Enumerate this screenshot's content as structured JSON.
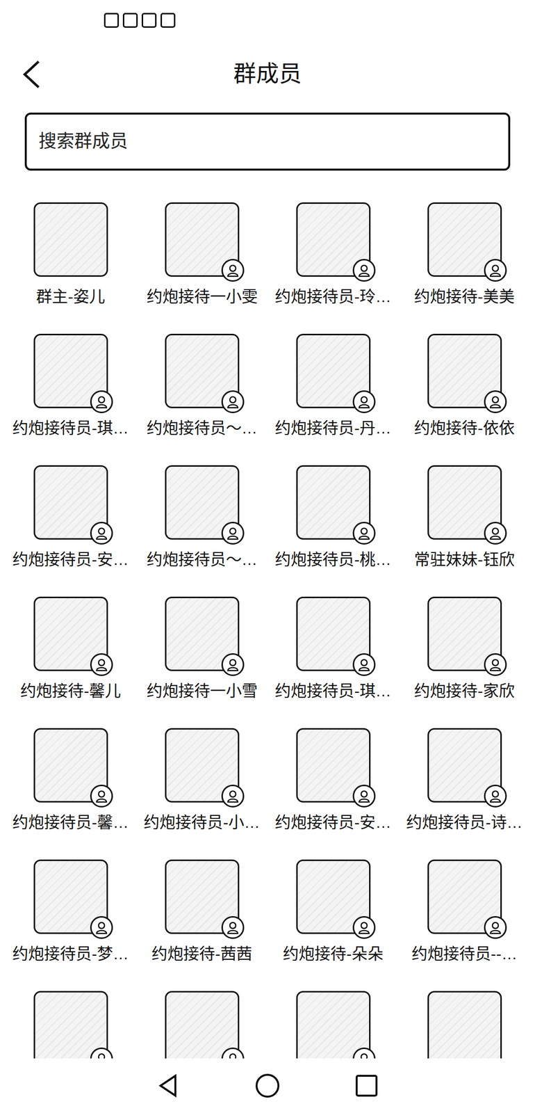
{
  "header": {
    "title": "群成员"
  },
  "search": {
    "placeholder": "搜索群成员"
  },
  "members": [
    {
      "label": "群主-姿儿",
      "badge": false
    },
    {
      "label": "约炮接待一小雯",
      "badge": true
    },
    {
      "label": "约炮接待员-玲…",
      "badge": true
    },
    {
      "label": "约炮接待-美美",
      "badge": true
    },
    {
      "label": "约炮接待员-琪…",
      "badge": true
    },
    {
      "label": "约炮接待员～…",
      "badge": true
    },
    {
      "label": "约炮接待员-丹…",
      "badge": true
    },
    {
      "label": "约炮接待-依依",
      "badge": true
    },
    {
      "label": "约炮接待员-安…",
      "badge": true
    },
    {
      "label": "约炮接待员～…",
      "badge": true
    },
    {
      "label": "约炮接待员-桃…",
      "badge": true
    },
    {
      "label": "常驻妹妹-钰欣",
      "badge": true
    },
    {
      "label": "约炮接待-馨儿",
      "badge": true
    },
    {
      "label": "约炮接待一小雪",
      "badge": true
    },
    {
      "label": "约炮接待员-琪…",
      "badge": true
    },
    {
      "label": "约炮接待-家欣",
      "badge": true
    },
    {
      "label": "约炮接待员-馨…",
      "badge": true
    },
    {
      "label": "约炮接待员-小…",
      "badge": true
    },
    {
      "label": "约炮接待员-安…",
      "badge": true
    },
    {
      "label": "约炮接待员-诗…",
      "badge": true
    },
    {
      "label": "约炮接待员-梦…",
      "badge": true
    },
    {
      "label": "约炮接待-茜茜",
      "badge": true
    },
    {
      "label": "约炮接待-朵朵",
      "badge": true
    },
    {
      "label": "约炮接待员--…",
      "badge": true
    },
    {
      "badge": true
    },
    {
      "badge": true
    },
    {
      "badge": true
    },
    {
      "badge": false
    }
  ]
}
